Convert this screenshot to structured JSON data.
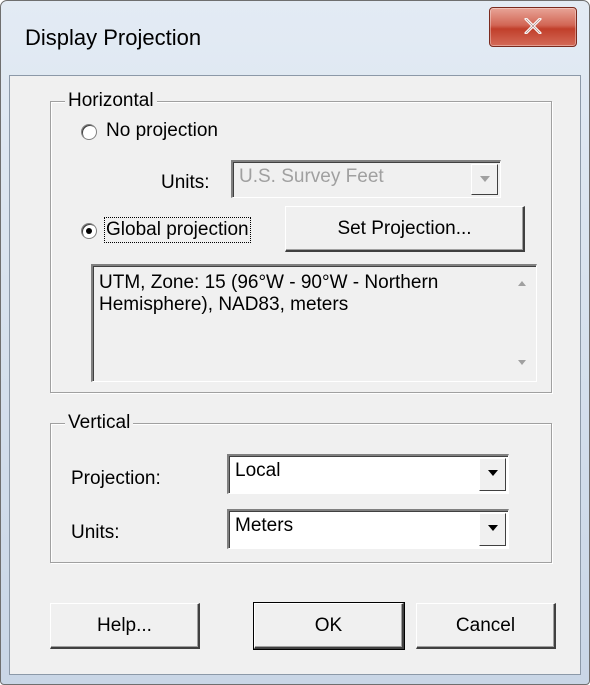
{
  "dialog": {
    "title": "Display Projection"
  },
  "horizontal": {
    "group_label": "Horizontal",
    "no_projection_label": "No projection",
    "units_label": "Units:",
    "units_value": "U.S. Survey Feet",
    "global_projection_label": "Global projection",
    "global_selected": true,
    "set_projection_label": "Set Projection...",
    "projection_description": "UTM, Zone: 15 (96°W - 90°W - Northern Hemisphere), NAD83, meters"
  },
  "vertical": {
    "group_label": "Vertical",
    "projection_label": "Projection:",
    "projection_value": "Local",
    "units_label": "Units:",
    "units_value": "Meters"
  },
  "buttons": {
    "help": "Help...",
    "ok": "OK",
    "cancel": "Cancel"
  },
  "icons": {
    "close": "close-icon",
    "dropdown": "chevron-down-icon"
  },
  "colors": {
    "close_button": "#c13f2b",
    "dialog_face": "#f0f0f0",
    "disabled_text": "#a0a0a0"
  }
}
